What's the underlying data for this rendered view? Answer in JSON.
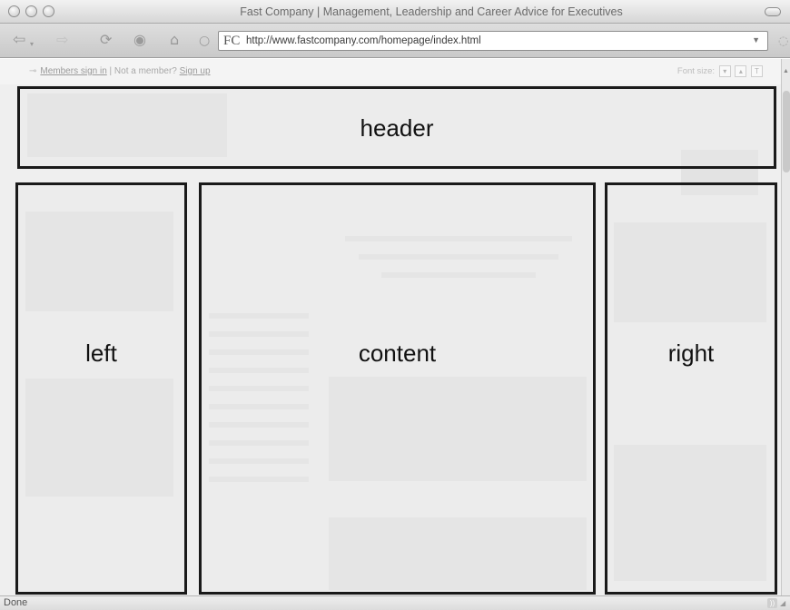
{
  "window": {
    "title": "Fast Company | Management, Leadership and Career Advice for Executives"
  },
  "toolbar": {
    "favicon_text": "FC",
    "url": "http://www.fastcompany.com/homepage/index.html",
    "icons": [
      "back-arrow-icon",
      "forward-arrow-icon",
      "reload-icon",
      "stop-icon",
      "home-icon",
      "ssl-icon",
      "url-dropdown-icon",
      "spinner-icon"
    ]
  },
  "page": {
    "members_sign_in": "Members sign in",
    "not_member": "Not a member?",
    "sign_up": "Sign up",
    "font_size_label": "Font size:"
  },
  "regions": {
    "header": "header",
    "left": "left",
    "content": "content",
    "right": "right"
  },
  "statusbar": {
    "text": "Done"
  }
}
